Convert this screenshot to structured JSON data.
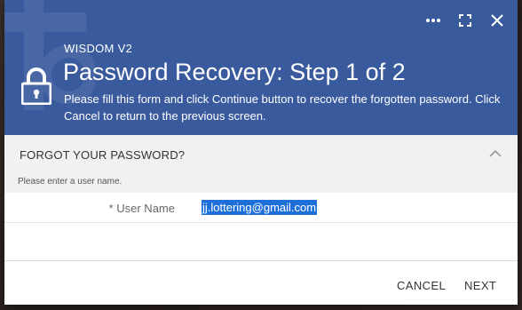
{
  "window": {
    "app_name": "WISDOM V2",
    "icons": [
      "more-icon",
      "maximize-icon",
      "close-icon"
    ]
  },
  "header": {
    "title": "Password Recovery: Step 1 of 2",
    "description": "Please fill this form and click Continue button to recover the forgotten password. Click Cancel to return to the previous screen.",
    "color": "#3a5a9e"
  },
  "section": {
    "title": "FORGOT YOUR PASSWORD?",
    "hint": "Please enter a user name."
  },
  "form": {
    "user_name_label": "* User Name",
    "user_name_value": "jj.lottering@gmail.com"
  },
  "footer": {
    "cancel_label": "CANCEL",
    "next_label": "NEXT"
  }
}
